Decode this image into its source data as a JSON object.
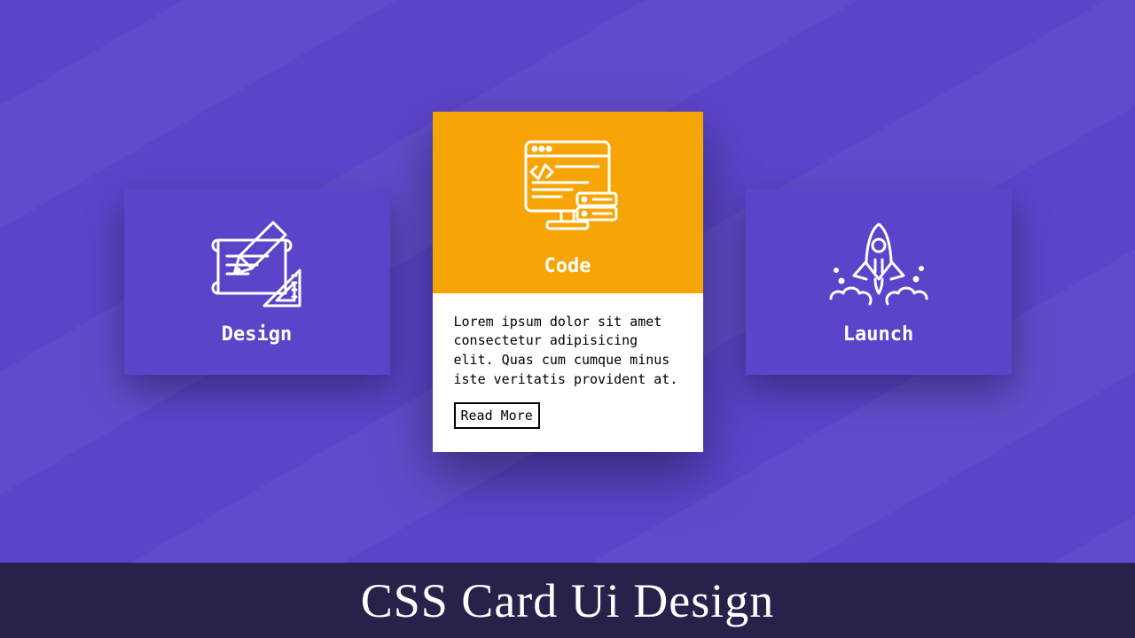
{
  "cards": [
    {
      "title": "Design",
      "icon": "design-icon"
    },
    {
      "title": "Code",
      "icon": "code-icon",
      "body": "Lorem ipsum dolor sit amet consectetur adipisicing elit. Quas cum cumque minus iste veritatis provident at.",
      "cta": "Read More"
    },
    {
      "title": "Launch",
      "icon": "launch-icon"
    }
  ],
  "footer": "CSS Card Ui Design",
  "colors": {
    "background": "#5b44c9",
    "accent": "#f6a406",
    "footer": "#26224a",
    "text_light": "#ffffff",
    "text_dark": "#000000"
  }
}
